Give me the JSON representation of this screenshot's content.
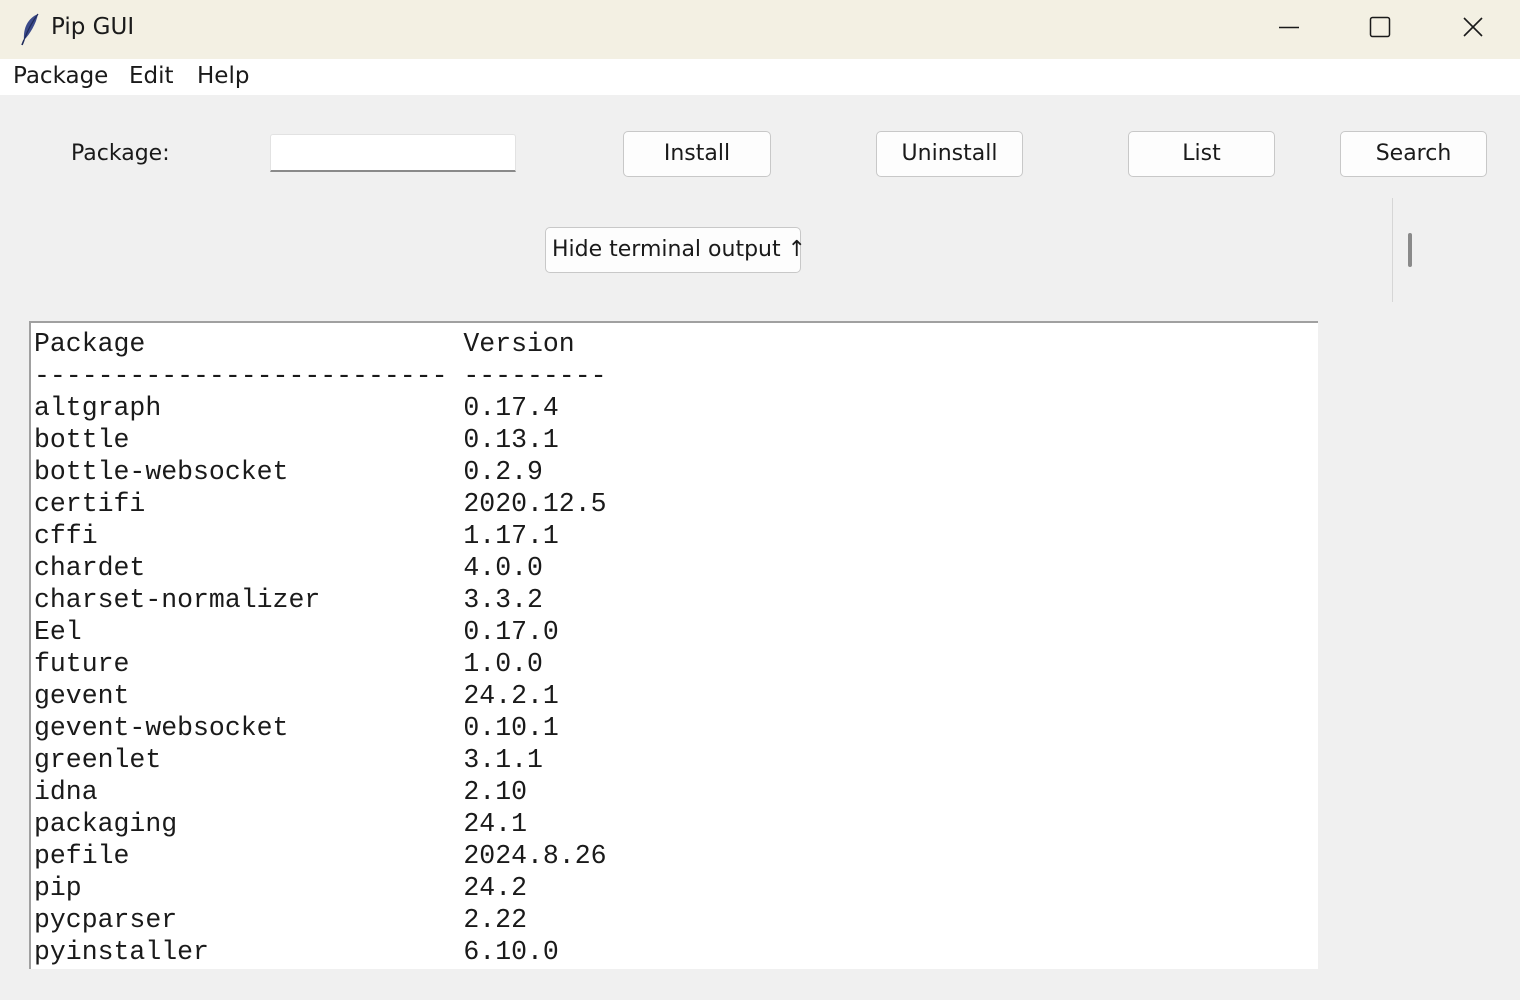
{
  "window": {
    "title": "Pip GUI",
    "icon": "feather-icon",
    "controls": [
      "minimize-icon",
      "maximize-icon",
      "close-icon"
    ]
  },
  "menu": {
    "items": [
      "Package",
      "Edit",
      "Help"
    ]
  },
  "form": {
    "package_label": "Package:",
    "package_value": "",
    "install_label": "Install",
    "uninstall_label": "Uninstall",
    "list_label": "List",
    "search_label": "Search",
    "hide_terminal_label": "Hide terminal output ↑"
  },
  "terminal": {
    "header": [
      "Package",
      "Version"
    ],
    "separator": [
      "--------------------------",
      "---------"
    ],
    "rows": [
      [
        "altgraph",
        "0.17.4"
      ],
      [
        "bottle",
        "0.13.1"
      ],
      [
        "bottle-websocket",
        "0.2.9"
      ],
      [
        "certifi",
        "2020.12.5"
      ],
      [
        "cffi",
        "1.17.1"
      ],
      [
        "chardet",
        "4.0.0"
      ],
      [
        "charset-normalizer",
        "3.3.2"
      ],
      [
        "Eel",
        "0.17.0"
      ],
      [
        "future",
        "1.0.0"
      ],
      [
        "gevent",
        "24.2.1"
      ],
      [
        "gevent-websocket",
        "0.10.1"
      ],
      [
        "greenlet",
        "3.1.1"
      ],
      [
        "idna",
        "2.10"
      ],
      [
        "packaging",
        "24.1"
      ],
      [
        "pefile",
        "2024.8.26"
      ],
      [
        "pip",
        "24.2"
      ],
      [
        "pycparser",
        "2.22"
      ],
      [
        "pyinstaller",
        "6.10.0"
      ]
    ]
  }
}
